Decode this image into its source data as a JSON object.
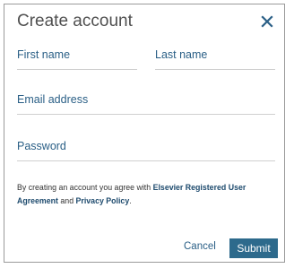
{
  "dialog": {
    "title": "Create account",
    "close_icon": "close-icon",
    "fields": {
      "first_name": "First name",
      "last_name": "Last name",
      "email": "Email address",
      "password": "Password"
    },
    "agreement": {
      "prefix": "By creating an account you agree with",
      "link1": "Elsevier Registered User Agreement",
      "middle": "and",
      "link2": "Privacy Policy",
      "suffix": "."
    },
    "buttons": {
      "cancel": "Cancel",
      "submit": "Submit"
    }
  },
  "colors": {
    "accent": "#2d6a8c",
    "label": "#2a5f86",
    "link": "#1d4a6d"
  }
}
